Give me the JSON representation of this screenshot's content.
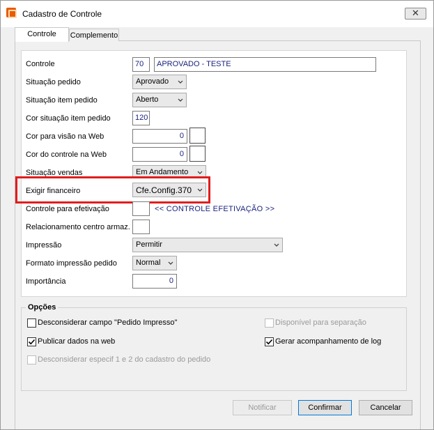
{
  "window": {
    "title": "Cadastro de Controle",
    "close_glyph": "✕"
  },
  "tabs": [
    {
      "label": "Controle"
    },
    {
      "label": "Complemento"
    }
  ],
  "form": {
    "controle": {
      "label": "Controle",
      "code": "70",
      "name": "APROVADO - TESTE"
    },
    "situacao_pedido": {
      "label": "Situação pedido",
      "value": "Aprovado"
    },
    "situacao_item_pedido": {
      "label": "Situação item pedido",
      "value": "Aberto"
    },
    "cor_situacao_item_pedido": {
      "label": "Cor situação item pedido",
      "value": "120"
    },
    "cor_visao_web": {
      "label": "Cor para visão na Web",
      "value": "0"
    },
    "cor_controle_web": {
      "label": "Cor do controle na Web",
      "value": "0"
    },
    "situacao_vendas": {
      "label": "Situação vendas",
      "value": "Em Andamento"
    },
    "exigir_financeiro": {
      "label": "Exigir financeiro",
      "value": "Cfe.Config.370"
    },
    "controle_efetivacao": {
      "label": "Controle para efetivação",
      "value": "",
      "link": "<< CONTROLE EFETIVAÇÃO >>"
    },
    "relacionamento_centro": {
      "label": "Relacionamento centro armaz.",
      "value": ""
    },
    "impressao": {
      "label": "Impressão",
      "value": "Permitir"
    },
    "formato_impressao": {
      "label": "Formato impressão pedido",
      "value": "Normal"
    },
    "importancia": {
      "label": "Importância",
      "value": "0"
    }
  },
  "opcoes": {
    "title": "Opções",
    "items": [
      {
        "label": "Desconsiderar campo \"Pedido Impresso\"",
        "checked": false,
        "enabled": true
      },
      {
        "label": "Disponível para separação",
        "checked": false,
        "enabled": false
      },
      {
        "label": "Publicar dados na web",
        "checked": true,
        "enabled": true
      },
      {
        "label": "Gerar acompanhamento de log",
        "checked": true,
        "enabled": true
      },
      {
        "label": "Desconsiderar especif 1 e 2 do cadastro do pedido",
        "checked": false,
        "enabled": false
      }
    ]
  },
  "buttons": {
    "notificar": "Notificar",
    "confirmar": "Confirmar",
    "cancelar": "Cancelar"
  },
  "colors": {
    "highlight": "#e01d1d",
    "field_text": "#1a237e"
  }
}
